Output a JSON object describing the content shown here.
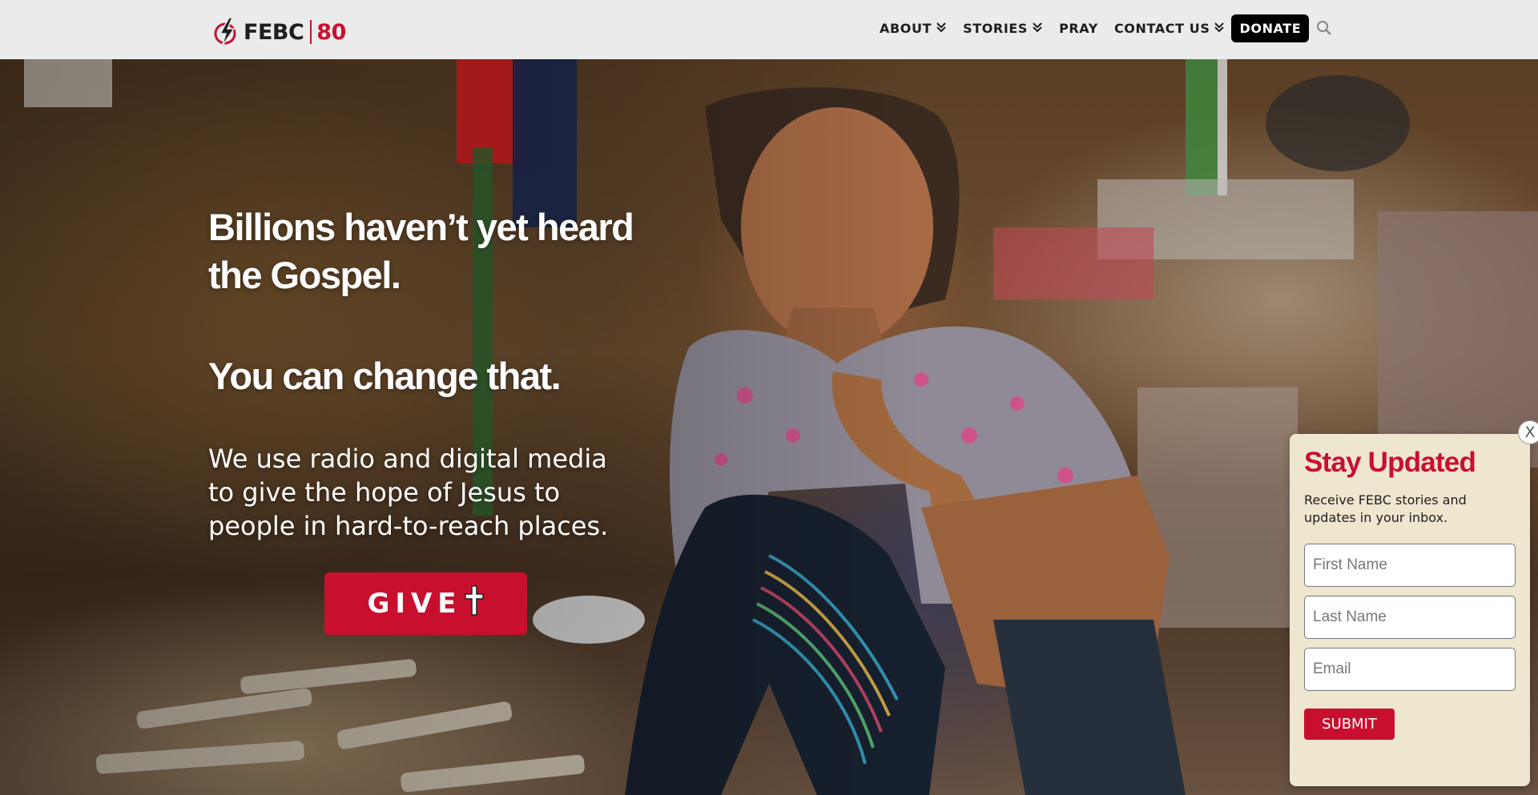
{
  "header": {
    "logo": {
      "brand": "FEBC",
      "anniversary": "80"
    },
    "nav": {
      "about": "ABOUT",
      "stories": "STORIES",
      "pray": "PRAY",
      "contact": "CONTACT US",
      "donate": "DONATE"
    },
    "icons": {
      "search": "search-icon",
      "dropdown": "double-chevron-down-icon"
    }
  },
  "hero": {
    "headline": "Billions haven’t yet heard the Gospel.",
    "subhead": "You can change that.",
    "body": "We use radio and digital media to give the hope of Jesus to people in hard-to-reach places.",
    "give_label": "GIVE",
    "give_icon": "cross-icon"
  },
  "popup": {
    "close_label": "X",
    "title": "Stay Updated",
    "description": "Receive FEBC stories and updates in your inbox.",
    "first_name_placeholder": "First Name",
    "last_name_placeholder": "Last Name",
    "email_placeholder": "Email",
    "submit_label": "SUBMIT"
  },
  "colors": {
    "brand_red": "#c8102e",
    "header_bg": "#ebebeb",
    "popup_bg": "#efe6d0",
    "donate_bg": "#000000"
  }
}
